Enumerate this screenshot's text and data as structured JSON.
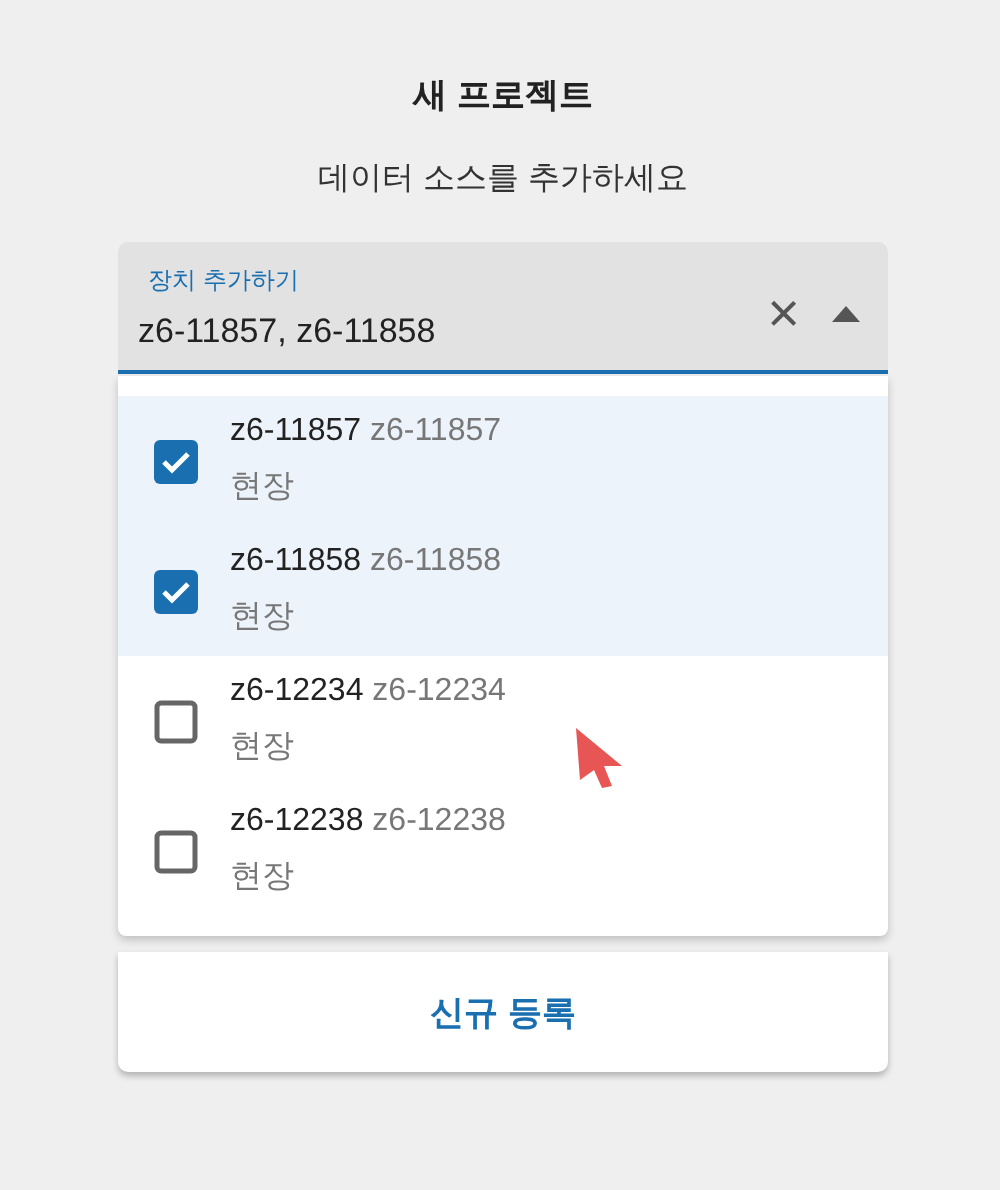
{
  "dialog": {
    "title": "새 프로젝트",
    "subtitle": "데이터 소스를 추가하세요"
  },
  "field": {
    "label": "장치 추가하기",
    "value": "z6-11857, z6-11858",
    "clear_icon": "×",
    "expanded": true
  },
  "options": [
    {
      "name": "z6-11857",
      "code": "z6-11857",
      "type": "현장",
      "checked": true
    },
    {
      "name": "z6-11858",
      "code": "z6-11858",
      "type": "현장",
      "checked": true
    },
    {
      "name": "z6-12234",
      "code": "z6-12234",
      "type": "현장",
      "checked": false
    },
    {
      "name": "z6-12238",
      "code": "z6-12238",
      "type": "현장",
      "checked": false
    }
  ],
  "register_button": "신규 등록"
}
